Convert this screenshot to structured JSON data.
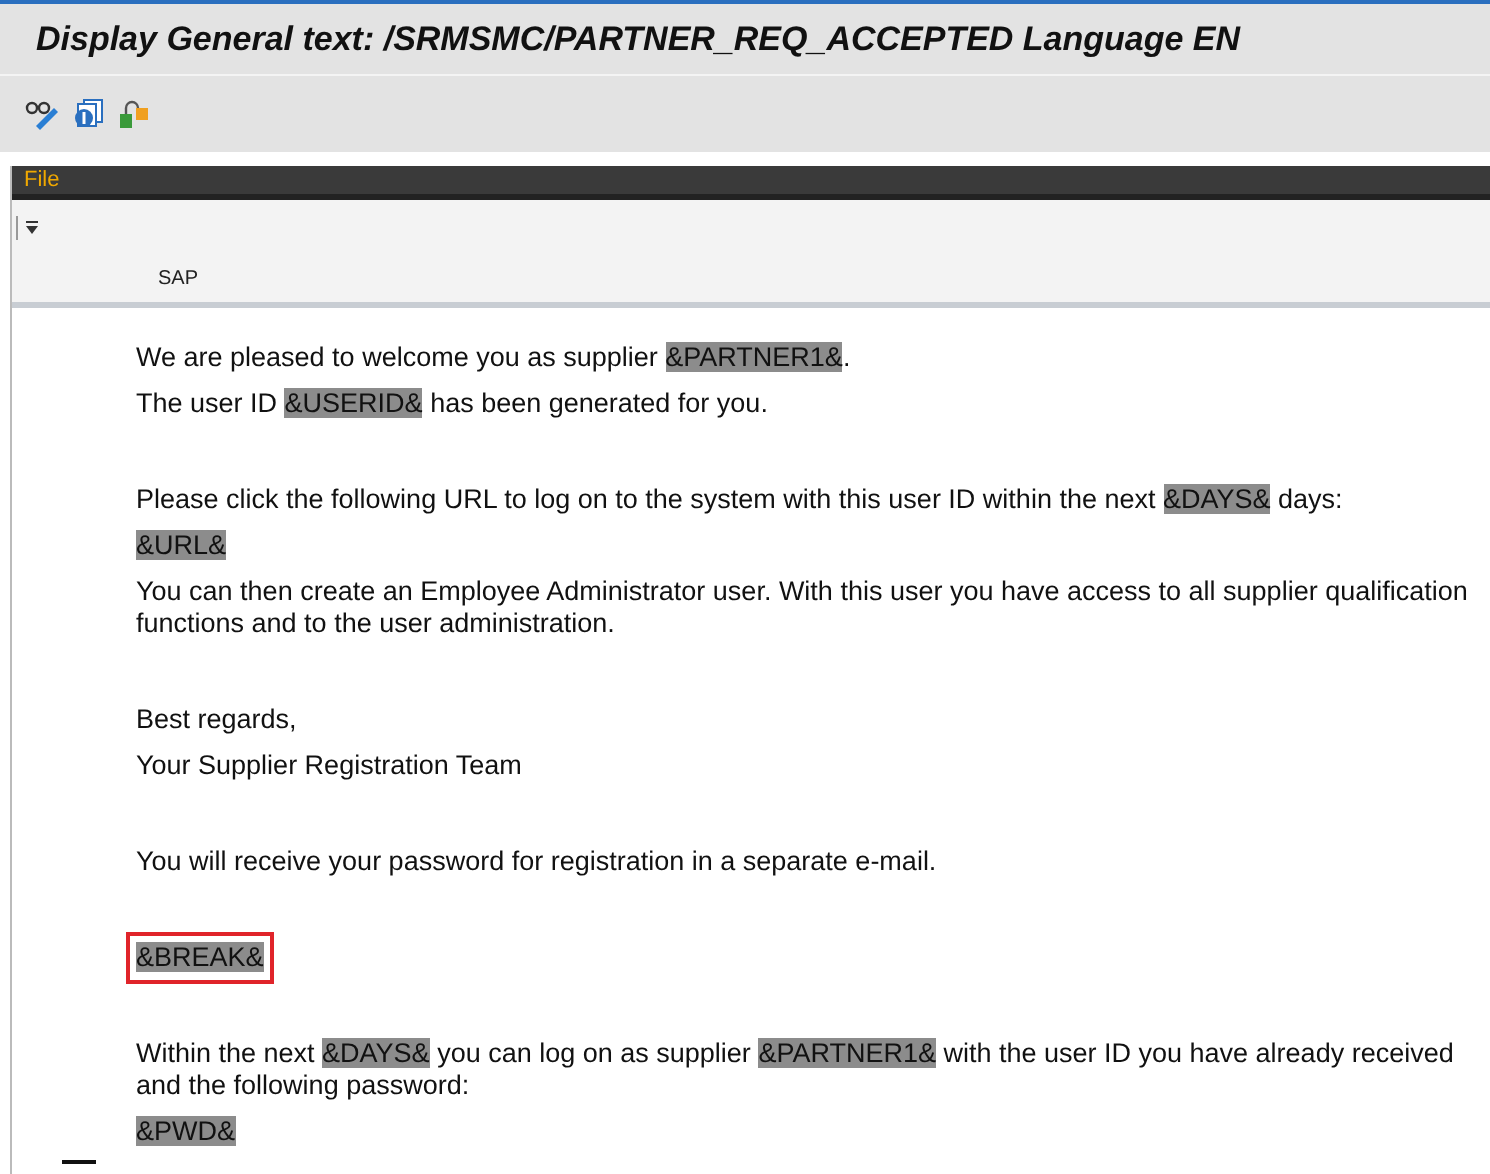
{
  "window": {
    "title": "Display General text: /SRMSMC/PARTNER_REQ_ACCEPTED Language EN"
  },
  "menu_bar": {
    "items": [
      "File"
    ]
  },
  "editor_header": {
    "label": "SAP"
  },
  "document": {
    "blocks": [
      {
        "paragraphs": [
          {
            "segments": [
              {
                "kind": "text",
                "text": "We are pleased to welcome you as supplier "
              },
              {
                "kind": "field",
                "text": "&PARTNER1&"
              },
              {
                "kind": "text",
                "text": "."
              }
            ]
          },
          {
            "segments": [
              {
                "kind": "text",
                "text": "The user ID "
              },
              {
                "kind": "field",
                "text": "&USERID&"
              },
              {
                "kind": "text",
                "text": " has been generated for you."
              }
            ]
          }
        ]
      },
      {
        "paragraphs": [
          {
            "segments": [
              {
                "kind": "text",
                "text": "Please click the following URL to log on to the system with this user ID within the next "
              },
              {
                "kind": "field",
                "text": "&DAYS&"
              },
              {
                "kind": "text",
                "text": " days:"
              }
            ]
          },
          {
            "segments": [
              {
                "kind": "field",
                "text": "&URL&"
              }
            ]
          },
          {
            "segments": [
              {
                "kind": "text",
                "text": "You can then create an Employee Administrator user. With this user you have access to all supplier qualification functions and to the user administration."
              }
            ]
          }
        ]
      },
      {
        "paragraphs": [
          {
            "segments": [
              {
                "kind": "text",
                "text": "Best regards,"
              }
            ]
          },
          {
            "segments": [
              {
                "kind": "text",
                "text": "Your Supplier Registration Team"
              }
            ]
          }
        ]
      },
      {
        "paragraphs": [
          {
            "segments": [
              {
                "kind": "text",
                "text": "You will receive your password for registration in a separate e-mail."
              }
            ]
          }
        ]
      },
      {
        "paragraphs": [
          {
            "outlined": true,
            "segments": [
              {
                "kind": "field",
                "text": "&BREAK&"
              }
            ]
          }
        ]
      },
      {
        "paragraphs": [
          {
            "segments": [
              {
                "kind": "text",
                "text": "Within the next "
              },
              {
                "kind": "field",
                "text": "&DAYS&"
              },
              {
                "kind": "text",
                "text": " you can log on as supplier "
              },
              {
                "kind": "field",
                "text": "&PARTNER1&"
              },
              {
                "kind": "text",
                "text": " with the user ID you have already received and the following password:"
              }
            ]
          },
          {
            "segments": [
              {
                "kind": "field",
                "text": "&PWD&"
              }
            ]
          }
        ]
      }
    ]
  }
}
